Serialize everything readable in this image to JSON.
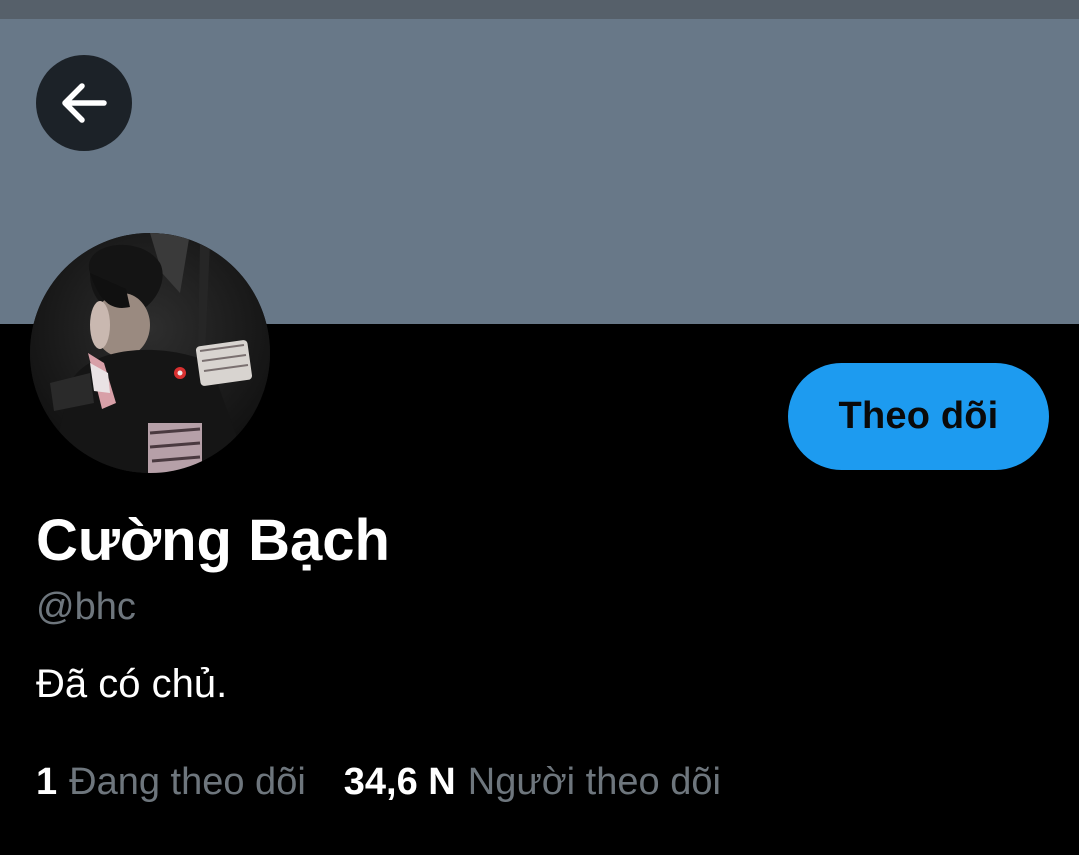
{
  "header": {
    "back_icon": "arrow-left-icon",
    "banner_color": "#687888"
  },
  "profile": {
    "display_name": "Cường Bạch",
    "handle": "@bhc",
    "bio": "Đã có chủ.",
    "follow_label": "Theo dõi",
    "accent": "#1d9bf0"
  },
  "stats": {
    "following_count": "1",
    "following_label": "Đang theo dõi",
    "followers_count": "34,6 N",
    "followers_label": "Người theo dõi"
  }
}
